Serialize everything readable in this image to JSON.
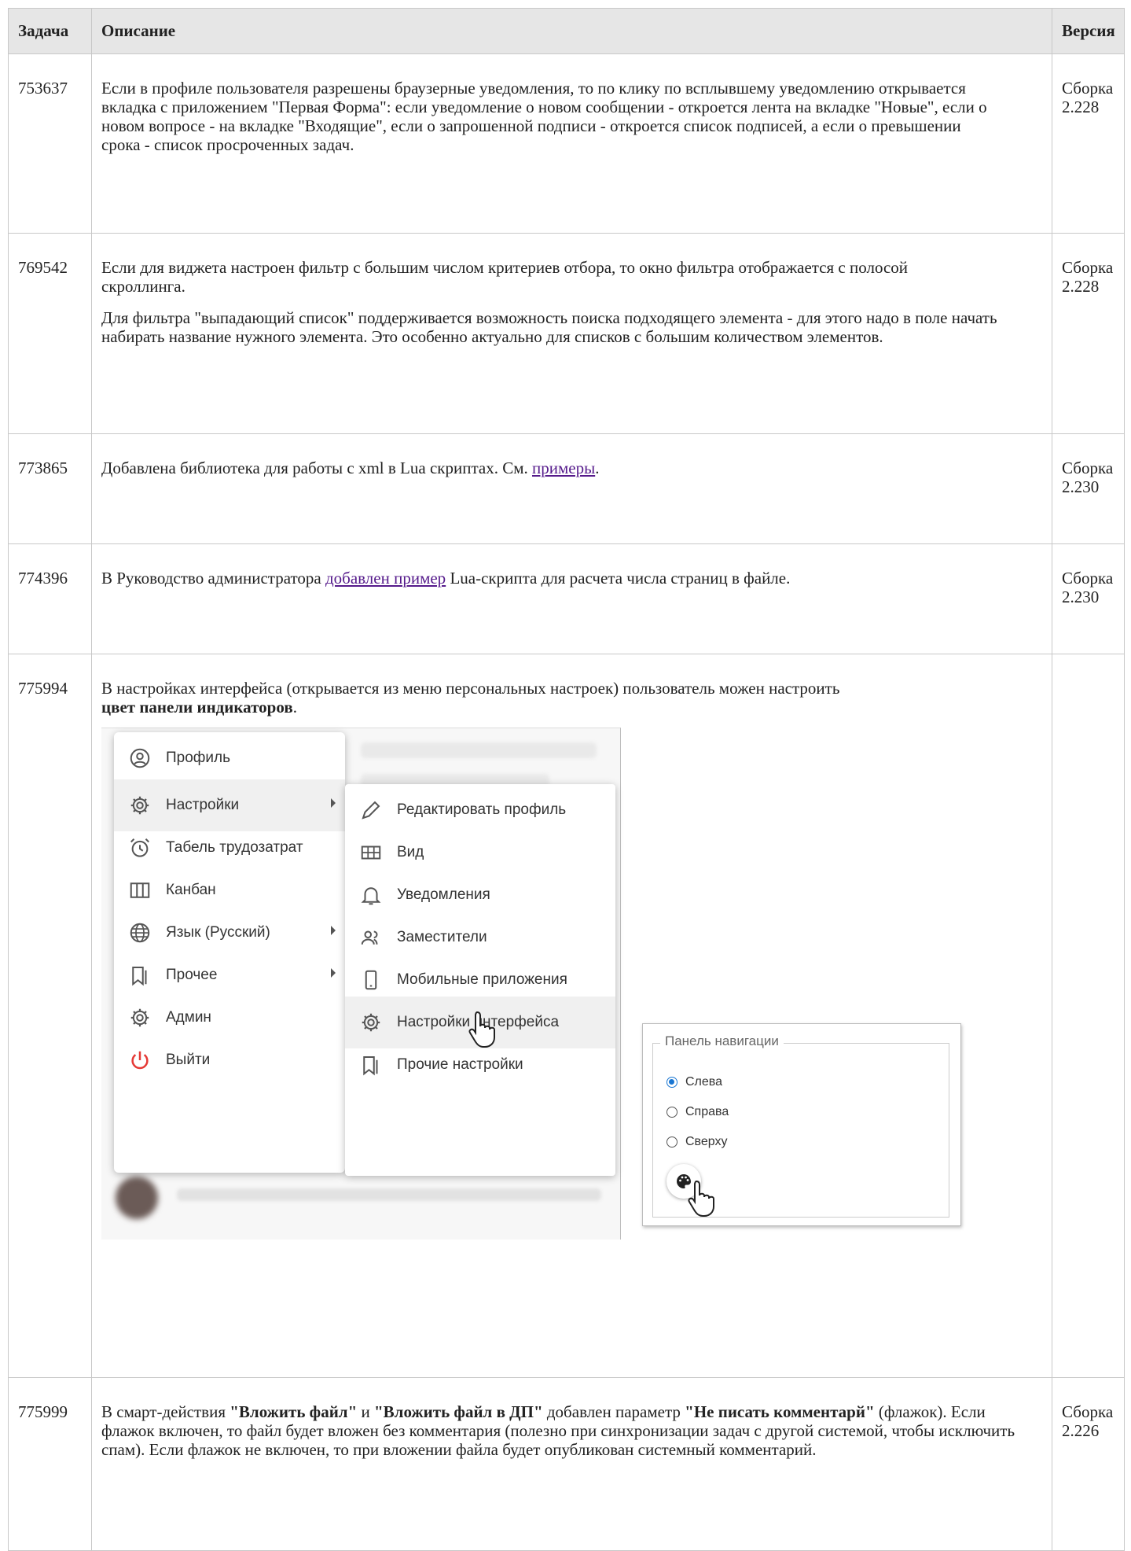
{
  "header": {
    "task": "Задача",
    "description": "Описание",
    "version": "Версия"
  },
  "rows": [
    {
      "id": "753637",
      "version": "Сборка 2.228",
      "text": "Если в профиле пользователя разрeшены браузерные уведомления, то по клику по всплывшему уведомлению открывается вкладка с приложением \"Первая Форма\": если уведомление о новом сообщении - откроется лента на вкладке \"Новые\", если о новом вопросе - на вкладке \"Входящие\", если о запрошенной подписи - откроется список подписей, а если о превышении срока - список просроченных задач."
    },
    {
      "id": "769542",
      "version": "Сборка 2.228",
      "p1": "Если для виджета настроен фильтр с большим числом критериев отбора, то окно фильтра отображается с полосой скроллинга.",
      "p2": "Для фильтра \"выпадающий список\" поддерживается возможность поиска подходящего элемента - для этого надо в поле начать набирать название нужного элемента. Это особенно актуально для списков с большим количеством элементов."
    },
    {
      "id": "773865",
      "version": "Сборка 2.230",
      "pre": "Добавлена библиотека для работы с xml в Lua скриптах. См. ",
      "link": "примеры",
      "post": "."
    },
    {
      "id": "774396",
      "version": "Сборка 2.230",
      "pre": "В Руководство администратора ",
      "link": "добавлен пример",
      "post": " Lua-скрипта для расчета числа страниц в файле."
    },
    {
      "id": "775994",
      "version": "",
      "pre": "В настройках интерфейса (открывается из меню персональных настроек) пользователь можен настроить ",
      "bold": "цвет панели индикаторов",
      "post": "."
    },
    {
      "id": "775999",
      "version": "Сборка 2.226",
      "t1": "В смарт-действия ",
      "b1": "\"Вложить файл\"",
      "t2": " и ",
      "b2": "\"Вложить файл в ДП\"",
      "t3": " добавлен параметр ",
      "b3": "\"Не писать комментарй\"",
      "t4": " (флажок). Если флажок включен, то файл будет вложен без комментария (полезно при синхронизации задач с другой системой, чтобы исключить спам). Если флажок не включен, то при вложении файла будет опубликован системный комментарий."
    }
  ],
  "menu": [
    {
      "label": "Профиль",
      "icon": "account-circle-icon"
    },
    {
      "label": "Настройки",
      "icon": "gear-icon"
    },
    {
      "label": "Табель трудозатрат",
      "icon": "alarm-clock-icon"
    },
    {
      "label": "Канбан",
      "icon": "kanban-columns-icon"
    },
    {
      "label": "Язык (Русский)",
      "icon": "globe-icon"
    },
    {
      "label": "Прочее",
      "icon": "bookmarks-icon"
    },
    {
      "label": "Админ",
      "icon": "gear-icon"
    },
    {
      "label": "Выйти",
      "icon": "power-icon"
    }
  ],
  "submenu": [
    {
      "label": "Редактировать профиль",
      "icon": "pencil-icon"
    },
    {
      "label": "Вид",
      "icon": "grid-icon"
    },
    {
      "label": "Уведомления",
      "icon": "bell-icon"
    },
    {
      "label": "Заместители",
      "icon": "people-icon"
    },
    {
      "label": "Мобильные приложения",
      "icon": "phone-icon"
    },
    {
      "label": "Настройки интерфейса",
      "icon": "gear-icon"
    },
    {
      "label": "Прочие настройки",
      "icon": "bookmarks-icon"
    }
  ],
  "navpanel": {
    "legend": "Панель навигации",
    "options": [
      "Слева",
      "Справа",
      "Сверху"
    ],
    "selected": 0,
    "accent": "#1976d2"
  },
  "colors": {
    "header_bg": "#e6e6e6",
    "border": "#c8c8c8",
    "link": "#551a8b",
    "logout": "#e53935"
  }
}
